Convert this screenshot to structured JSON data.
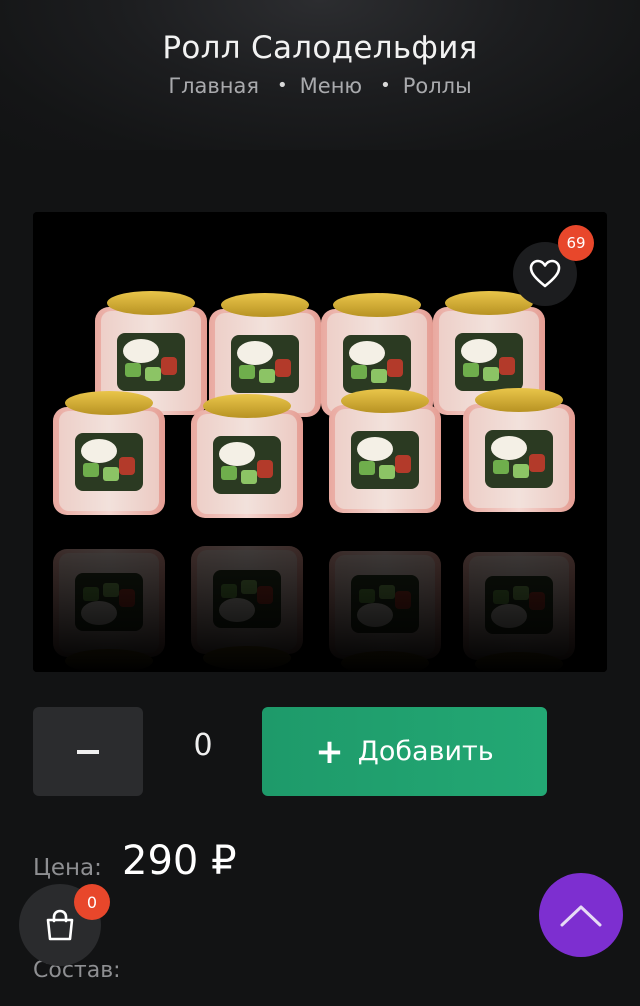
{
  "header": {
    "title": "Ролл Салодельфия",
    "breadcrumb": [
      "Главная",
      "Меню",
      "Роллы"
    ]
  },
  "product": {
    "image_alt": "Ролл Салодельфия",
    "favorite_count": "69",
    "quantity": "0",
    "add_label": "Добавить",
    "price_label": "Цена:",
    "price_value": "290 ₽",
    "composition_label": "Состав:"
  },
  "cart": {
    "count": "0"
  },
  "colors": {
    "accent_green": "#23a874",
    "badge_red": "#e8472b",
    "scroll_top_purple": "#7d2fd0"
  },
  "icons": {
    "favorite": "heart-icon",
    "cart": "shopping-bag-icon",
    "scroll_top": "chevron-up-icon",
    "minus": "minus-icon",
    "plus": "plus-icon"
  }
}
